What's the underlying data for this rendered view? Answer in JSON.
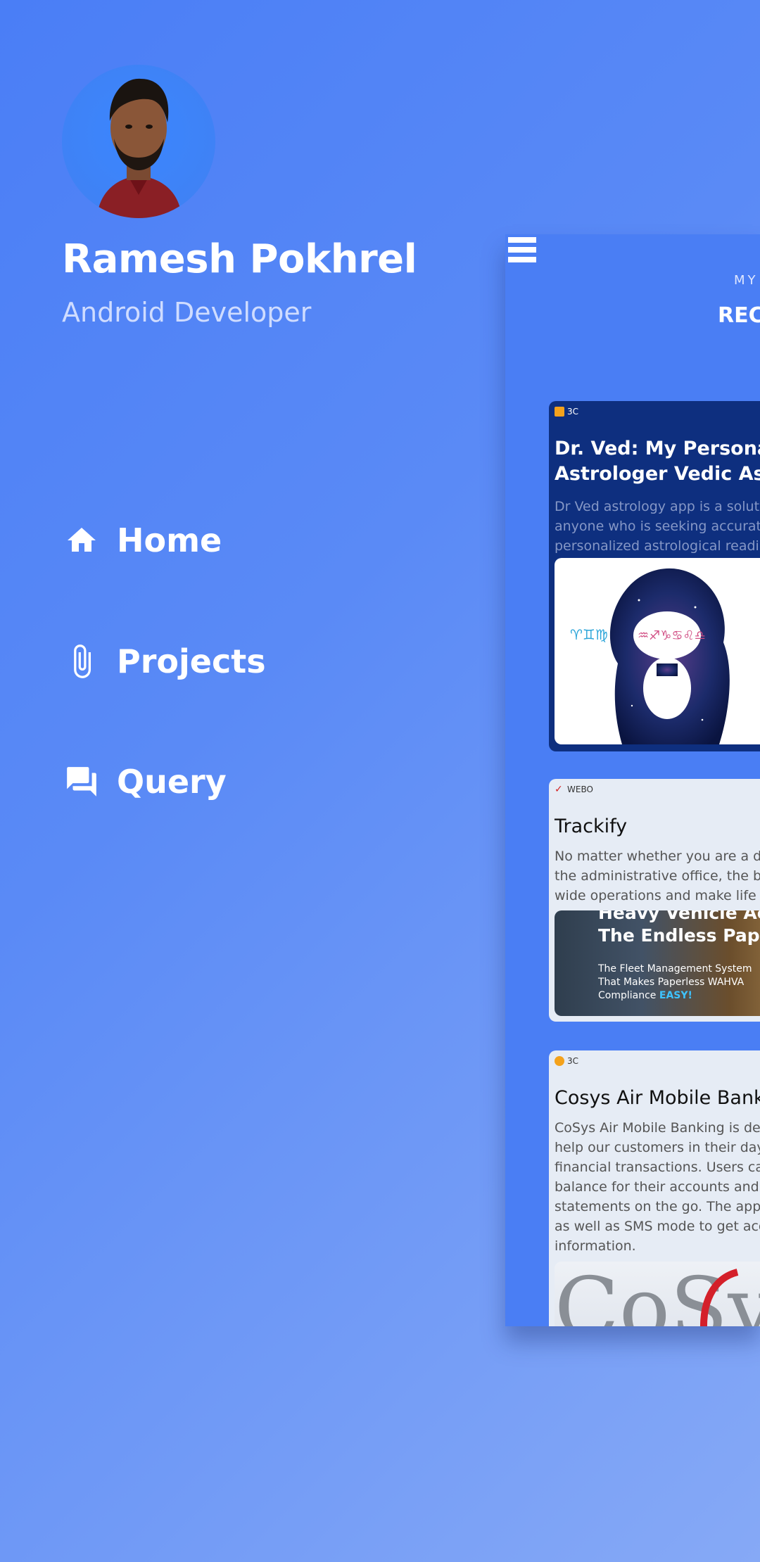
{
  "profile": {
    "name": "Ramesh Pokhrel",
    "role": "Android Developer"
  },
  "nav": {
    "items": [
      {
        "label": "Home",
        "icon": "home-icon"
      },
      {
        "label": "Projects",
        "icon": "paperclip-icon"
      },
      {
        "label": "Query",
        "icon": "chat-icon"
      }
    ]
  },
  "panel": {
    "subtitle": "MY",
    "title": "RECE",
    "cards": [
      {
        "company": "3C",
        "title_lines": [
          "Dr. Ved: My Personal",
          "Astrologer Vedic Astro"
        ],
        "desc_lines": [
          "Dr Ved astrology app is a solution",
          "anyone who is seeking accurate",
          "personalized astrological reading"
        ],
        "image_icons": [
          "♈♊♍",
          "♒♐♑♋♌♎"
        ]
      },
      {
        "company": "WEBO",
        "title_lines": [
          "Trackify"
        ],
        "desc_lines": [
          "No matter whether you are a driv",
          "the administrative office, the ben",
          "wide operations and make life ea"
        ],
        "banner": {
          "heading_lines": [
            "Heavy Vehicle Ac",
            "The Endless Pape"
          ],
          "body_lines": [
            "The Fleet Management System",
            "That Makes Paperless WAHVA"
          ],
          "compliance": "Compliance",
          "highlight": "EASY!"
        }
      },
      {
        "company": "3C",
        "title_lines": [
          "Cosys Air Mobile Bank"
        ],
        "desc_lines": [
          "CoSys Air Mobile Banking is desig",
          "help our customers in their day t",
          "financial transactions. Users can",
          "balance for their accounts and ge",
          "statements on the go. The app ha",
          "as well as SMS mode to get accou",
          "information."
        ],
        "logo_text": "CoSy"
      }
    ]
  },
  "colors": {
    "accent": "#4a7ef4",
    "card_dark": "#0e2f7f",
    "card_light": "#e6ecf5",
    "highlight": "#3ec3ff"
  }
}
